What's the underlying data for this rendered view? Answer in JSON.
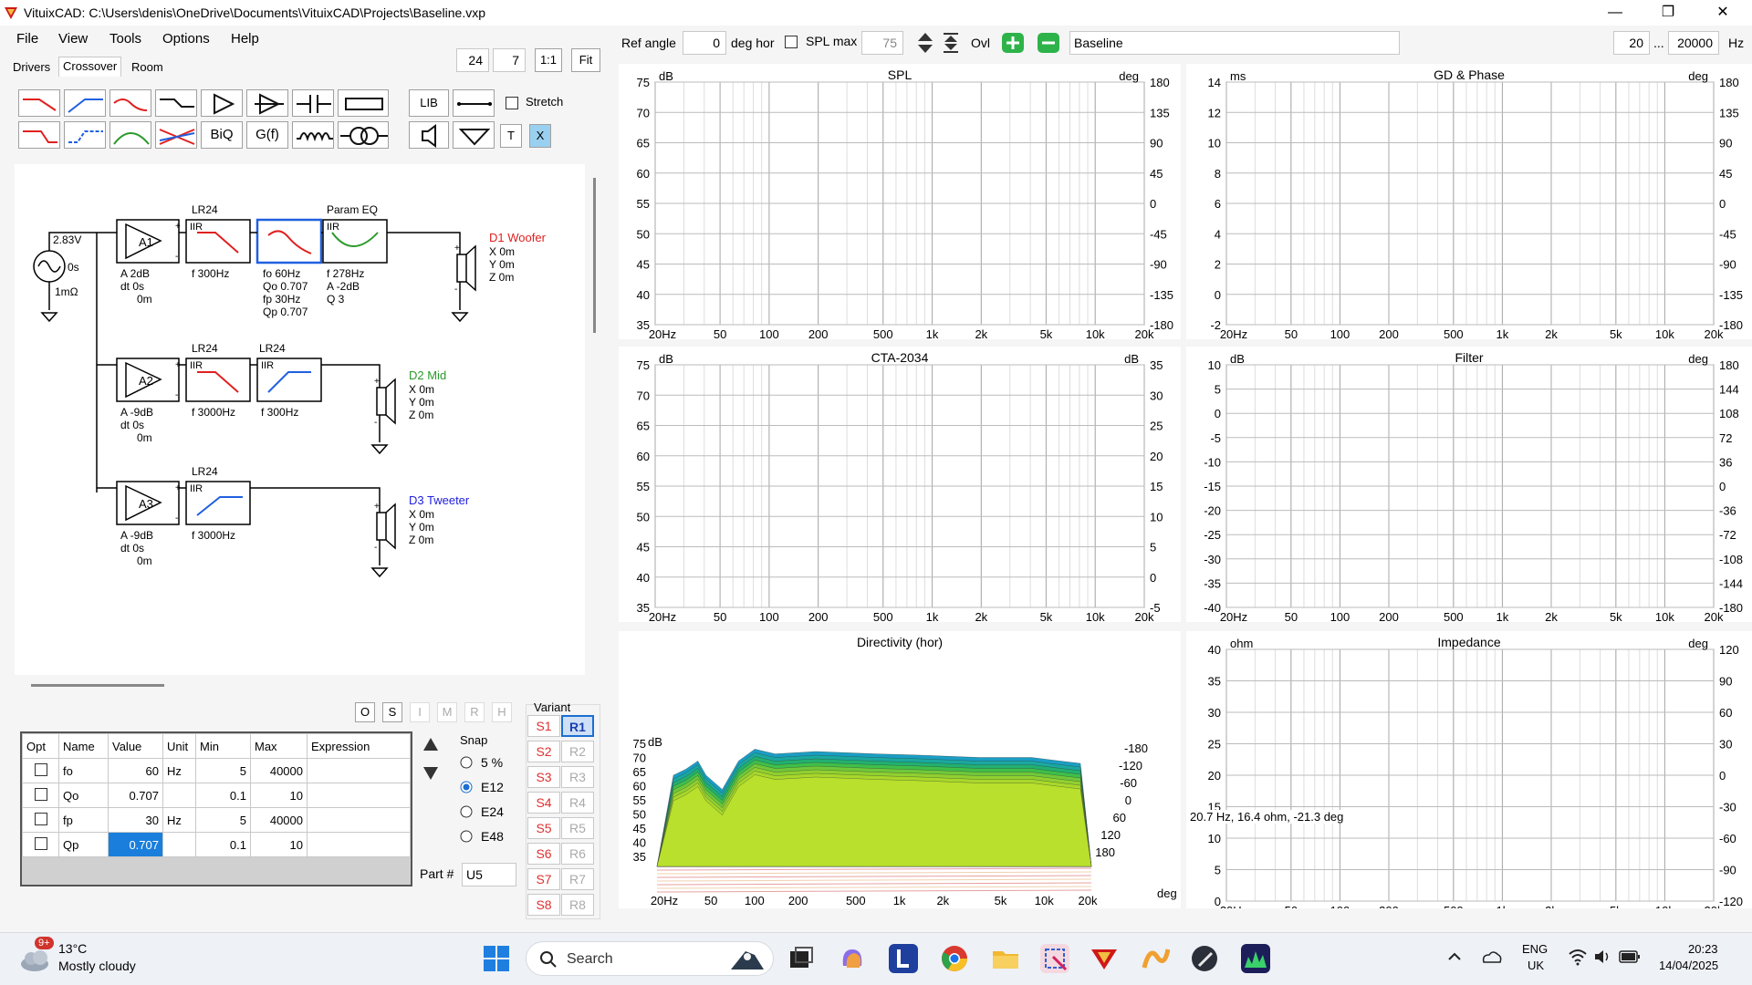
{
  "window": {
    "title": "VituixCAD: C:\\Users\\denis\\OneDrive\\Documents\\VituixCAD\\Projects\\Baseline.vxp",
    "minimize": "—",
    "maximize": "❐",
    "close": "✕"
  },
  "menu": [
    "File",
    "View",
    "Tools",
    "Options",
    "Help"
  ],
  "tabs": [
    "Drivers",
    "Crossover",
    "Room"
  ],
  "toolbar": {
    "zoom1": "24",
    "zoom2": "7",
    "ratio": "1:1",
    "fit": "Fit",
    "stretch": "Stretch",
    "lib": "LIB",
    "biq": "BiQ",
    "gf": "G(f)",
    "t": "T",
    "x": "X"
  },
  "topbar": {
    "ref_angle_label": "Ref angle",
    "ref_angle": "0",
    "deg_hor": "deg hor",
    "spl_max": "SPL max",
    "spl_max_val": "75",
    "ovl": "Ovl",
    "variant_name": "Baseline",
    "f_min": "20",
    "dots": "...",
    "f_max": "20000",
    "hz": "Hz"
  },
  "schematic": {
    "source": {
      "v": "2.83V",
      "t": "0s",
      "r": "1mΩ"
    },
    "w_lr24": "LR24",
    "w_peq": "Param EQ",
    "iir": "IIR",
    "a1": {
      "name": "A1",
      "a": "A  2dB",
      "dt": "dt 0s",
      "off": "0m"
    },
    "a2": {
      "name": "A2",
      "a": "A  -9dB",
      "dt": "dt 0s",
      "off": "0m"
    },
    "a3": {
      "name": "A3",
      "a": "A  -9dB",
      "dt": "dt 0s",
      "off": "0m"
    },
    "w_f": "f   300Hz",
    "w_fo": "fo  60Hz",
    "w_qo": "Qo 0.707",
    "w_fp": "fp  30Hz",
    "w_qp": "Qp 0.707",
    "w_peq_f": "f   278Hz",
    "w_peq_a": "A  -2dB",
    "w_peq_q": "Q  3",
    "m_lr1": "LR24",
    "m_lr2": "LR24",
    "m_f1": "f   3000Hz",
    "m_f2": "f   300Hz",
    "t_lr": "LR24",
    "t_f": "f   3000Hz",
    "d1": {
      "name": "D1 Woofer",
      "x": "X 0m",
      "y": "Y 0m",
      "z": "Z 0m",
      "color": "#e02020"
    },
    "d2": {
      "name": "D2 Mid",
      "x": "X 0m",
      "y": "Y 0m",
      "z": "Z 0m",
      "color": "#2a9a2a"
    },
    "d3": {
      "name": "D3 Tweeter",
      "x": "X 0m",
      "y": "Y 0m",
      "z": "Z 0m",
      "color": "#2020e0"
    }
  },
  "panel": {
    "o": "O",
    "s": "S",
    "i": "I",
    "m": "M",
    "r": "R",
    "h": "H",
    "variant": "Variant",
    "snap": "Snap",
    "snap_opts": [
      "5 %",
      "E12",
      "E24",
      "E48"
    ],
    "part_label": "Part #",
    "part": "U5",
    "s_buttons": [
      "S1",
      "S2",
      "S3",
      "S4",
      "S5",
      "S6",
      "S7",
      "S8"
    ],
    "r_buttons": [
      "R1",
      "R2",
      "R3",
      "R4",
      "R5",
      "R6",
      "R7",
      "R8"
    ]
  },
  "table": {
    "headers": [
      "Opt",
      "Name",
      "Value",
      "Unit",
      "Min",
      "Max",
      "Expression"
    ],
    "rows": [
      {
        "name": "fo",
        "value": "60",
        "unit": "Hz",
        "min": "5",
        "max": "40000"
      },
      {
        "name": "Qo",
        "value": "0.707",
        "unit": "",
        "min": "0.1",
        "max": "10"
      },
      {
        "name": "fp",
        "value": "30",
        "unit": "Hz",
        "min": "5",
        "max": "40000"
      },
      {
        "name": "Qp",
        "value": "0.707",
        "unit": "",
        "min": "0.1",
        "max": "10"
      }
    ]
  },
  "charts": {
    "spl": {
      "title": "SPL",
      "yl": "dB",
      "yr": "deg",
      "ylt": [
        "75",
        "70",
        "65",
        "60",
        "55",
        "50",
        "45",
        "40",
        "35"
      ],
      "yrt": [
        "180",
        "135",
        "90",
        "45",
        "0",
        "-45",
        "-90",
        "-135",
        "-180"
      ]
    },
    "gd": {
      "title": "GD & Phase",
      "yl": "ms",
      "yr": "deg",
      "ylt": [
        "14",
        "12",
        "10",
        "8",
        "6",
        "4",
        "2",
        "0",
        "-2"
      ],
      "yrt": [
        "180",
        "135",
        "90",
        "45",
        "0",
        "-45",
        "-90",
        "-135",
        "-180"
      ]
    },
    "cta": {
      "title": "CTA-2034",
      "yl": "dB",
      "yr": "dB",
      "ylt": [
        "75",
        "70",
        "65",
        "60",
        "55",
        "50",
        "45",
        "40",
        "35"
      ],
      "yrt": [
        "35",
        "30",
        "25",
        "20",
        "15",
        "10",
        "5",
        "0",
        "-5"
      ]
    },
    "filter": {
      "title": "Filter",
      "yl": "dB",
      "yr": "deg",
      "ylt": [
        "10",
        "5",
        "0",
        "-5",
        "-10",
        "-15",
        "-20",
        "-25",
        "-30",
        "-35",
        "-40"
      ],
      "yrt": [
        "180",
        "144",
        "108",
        "72",
        "36",
        "0",
        "-36",
        "-72",
        "-108",
        "-144",
        "-180"
      ]
    },
    "dir": {
      "title": "Directivity (hor)",
      "yl": "dB",
      "ylt": [
        "75",
        "70",
        "65",
        "60",
        "55",
        "50",
        "45",
        "40",
        "35"
      ],
      "angles": [
        "-180",
        "-120",
        "-60",
        "0",
        "60",
        "120",
        "180"
      ],
      "deg": "deg"
    },
    "imp": {
      "title": "Impedance",
      "yl": "ohm",
      "yr": "deg",
      "ylt": [
        "40",
        "35",
        "30",
        "25",
        "20",
        "15",
        "10",
        "5",
        "0"
      ],
      "yrt": [
        "120",
        "90",
        "60",
        "30",
        "0",
        "-30",
        "-60",
        "-90",
        "-120"
      ],
      "readout": "20.7 Hz, 16.4 ohm, -21.3 deg"
    },
    "xticks": [
      "20Hz",
      "50",
      "100",
      "200",
      "500",
      "1k",
      "2k",
      "5k",
      "10k",
      "20k"
    ]
  },
  "taskbar": {
    "weather_badge": "9+",
    "temp": "13°C",
    "cond": "Mostly cloudy",
    "search": "Search",
    "lang1": "ENG",
    "lang2": "UK",
    "time": "20:23",
    "date": "14/04/2025"
  }
}
